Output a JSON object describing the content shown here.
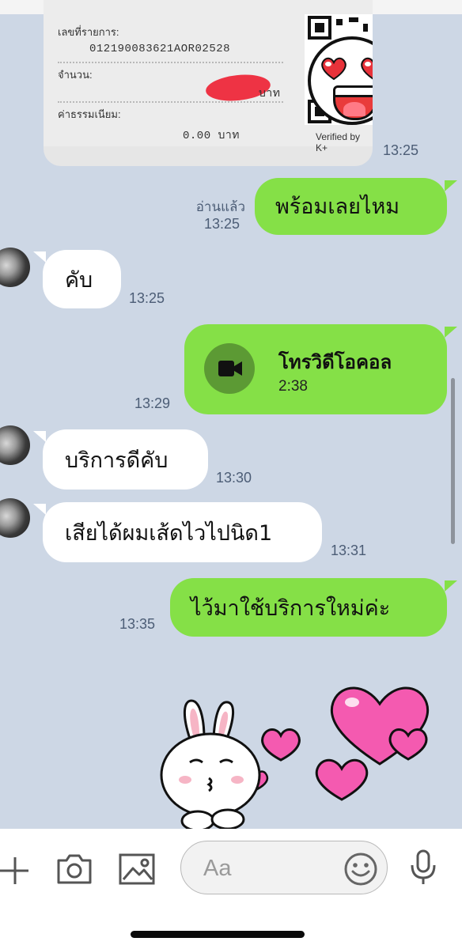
{
  "receipt": {
    "txn_label": "เลขที่รายการ:",
    "txn_value": "012190083621AOR02528",
    "amount_label": "จำนวน:",
    "amount_unit": "บาท",
    "fee_label": "ค่าธรรมเนียม:",
    "fee_value": "0.00 บาท",
    "verified": "Verified by K+",
    "time": "13:25"
  },
  "messages": [
    {
      "id": "m1",
      "side": "out",
      "text": "พร้อมเลยไหม",
      "read": "อ่านแล้ว",
      "time": "13:25"
    },
    {
      "id": "m2",
      "side": "in",
      "text": "คับ",
      "time": "13:25"
    },
    {
      "id": "m3",
      "side": "out",
      "type": "video-call",
      "title": "โทรวิดีโอคอล",
      "duration": "2:38",
      "time": "13:29"
    },
    {
      "id": "m4",
      "side": "in",
      "text": "บริการดีคับ",
      "time": "13:30"
    },
    {
      "id": "m5",
      "side": "in",
      "text": "เสียได้ผมเส้ดไวไปนิด1",
      "time": "13:31"
    },
    {
      "id": "m6",
      "side": "out",
      "text": "ไว้มาใช้บริการใหม่ค่ะ",
      "time": "13:35"
    }
  ],
  "composer": {
    "placeholder": "Aa",
    "icons": [
      "plus-icon",
      "camera-icon",
      "image-icon",
      "emoji-icon",
      "microphone-icon"
    ]
  },
  "colors": {
    "chat_background": "#cdd7e5",
    "outgoing_bubble": "#85e047",
    "incoming_bubble": "#ffffff",
    "timestamp": "#4c5d76"
  }
}
